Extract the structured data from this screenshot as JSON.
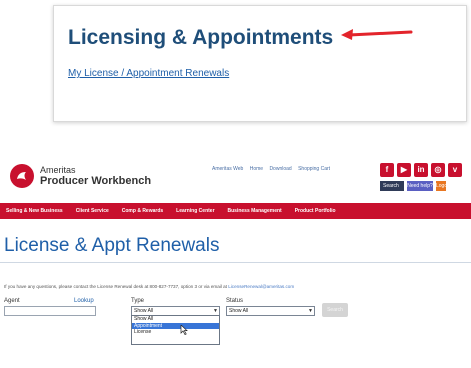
{
  "card": {
    "title": "Licensing & Appointments",
    "link": "My License / Appointment Renewals",
    "arrow_color": "#e3242b"
  },
  "portal": {
    "brand": {
      "name": "Ameritas",
      "product": "Producer Workbench",
      "color": "#c8102e"
    },
    "util_links": [
      "Ameritas Web",
      "Home",
      "Download",
      "Shopping Cart"
    ],
    "social_icons": [
      "facebook-icon",
      "youtube-icon",
      "linkedin-icon",
      "instagram-icon",
      "vimeo-icon"
    ],
    "search_label": "Search",
    "need_help_label": "Need help?",
    "logout_label": "Logout",
    "nav": [
      "Selling & New Business",
      "Client Service",
      "Comp & Rewards",
      "Learning Center",
      "Business Management",
      "Product Portfolio"
    ],
    "page_title": "License & Appt Renewals",
    "info_text": "If you have any questions, please contact the License Renewal desk at 800-827-7737, option 3 or via email at",
    "info_email": "LicenseRenewal@ameritas.com",
    "form": {
      "agent_label": "Agent",
      "agent_lookup": "Lookup",
      "type_label": "Type",
      "type_value": "Show All",
      "type_options": [
        "Show All",
        "Appointment",
        "License"
      ],
      "type_highlighted": "Appointment",
      "status_label": "Status",
      "status_value": "Show All",
      "search_button": "Search"
    }
  }
}
